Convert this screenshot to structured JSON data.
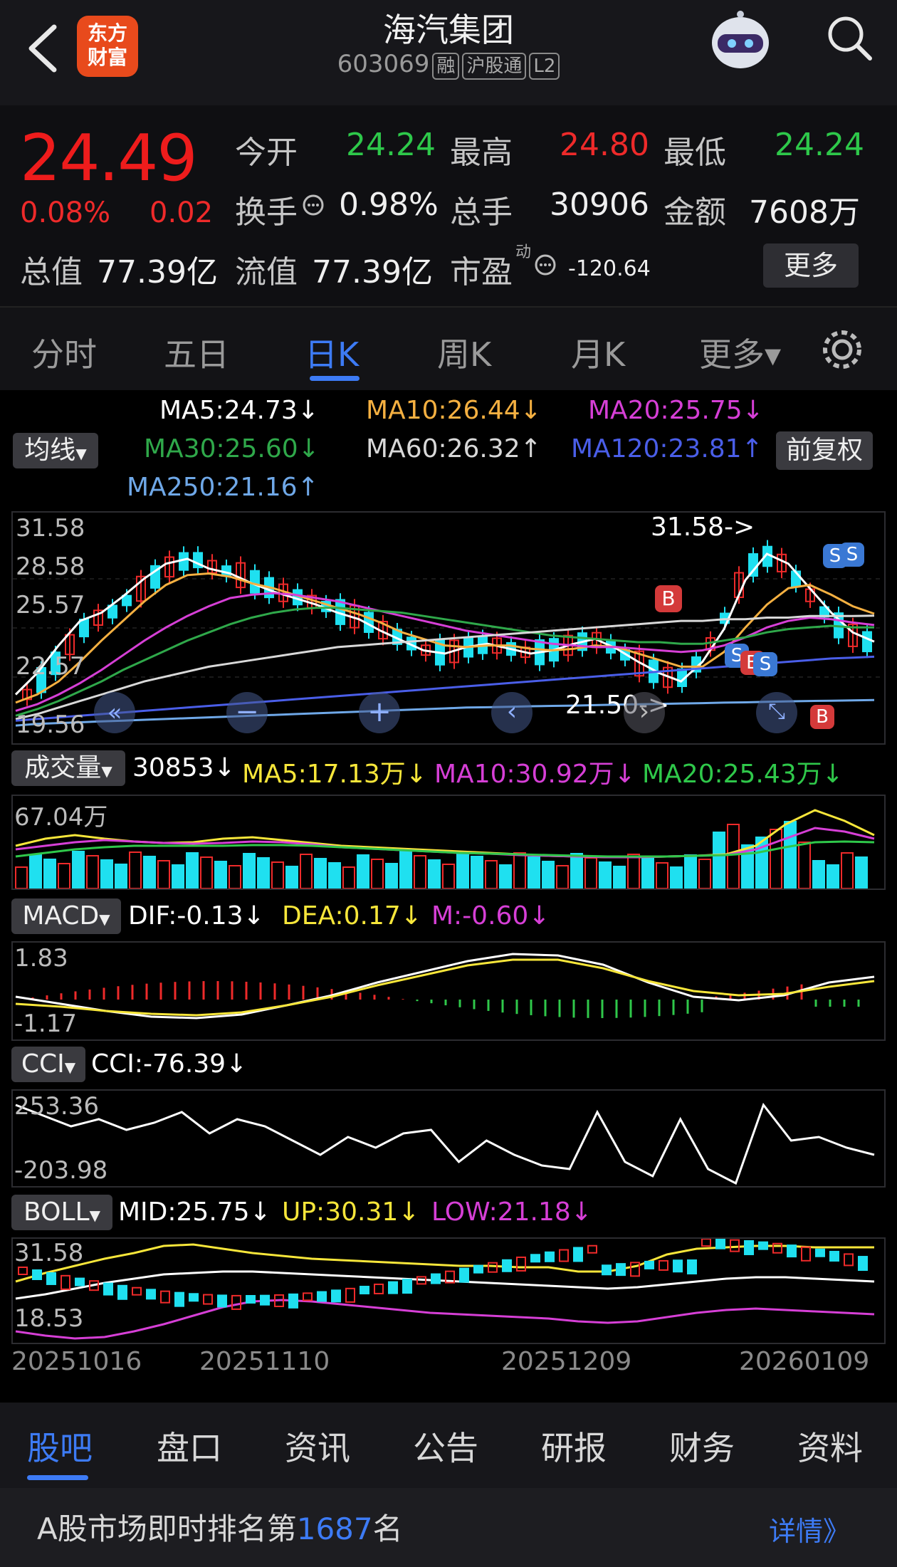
{
  "header": {
    "logo_text": "东方\n财富",
    "title": "海汽集团",
    "code": "603069",
    "tags": [
      "融",
      "沪股通",
      "L2"
    ]
  },
  "quote": {
    "price": "24.49",
    "change_pct": "0.08%",
    "change": "0.02",
    "open_label": "今开",
    "open": "24.24",
    "high_label": "最高",
    "high": "24.80",
    "low_label": "最低",
    "low": "24.24",
    "turnover_label": "换手",
    "turnover": "0.98%",
    "volume_label": "总手",
    "volume": "30906",
    "amount_label": "金额",
    "amount": "7608万",
    "mktcap_label": "总值",
    "mktcap": "77.39亿",
    "float_label": "流值",
    "float": "77.39亿",
    "pe_label": "市盈",
    "pe_sup": "动",
    "pe": "-120.64",
    "more_label": "更多"
  },
  "tabs": [
    "分时",
    "五日",
    "日K",
    "周K",
    "月K",
    "更多▾"
  ],
  "active_tab": 2,
  "ma_legend": {
    "ma5": "MA5:24.73↓",
    "ma10": "MA10:26.44↓",
    "ma20": "MA20:25.75↓",
    "ma30": "MA30:25.60↓",
    "ma60": "MA60:26.32↑",
    "ma120": "MA120:23.81↑",
    "ma250": "MA250:21.16↑",
    "selector": "均线",
    "adjust": "前复权"
  },
  "colors": {
    "ma5": "#ffffff",
    "ma10": "#f5b041",
    "ma20": "#d63fd6",
    "ma30": "#2fa84a",
    "ma60": "#d8d8d8",
    "ma120": "#4a5ee8",
    "ma250": "#6fa8e8",
    "up": "#ee2a2a",
    "down": "#1fe0f0"
  },
  "kline": {
    "y_ticks": [
      "31.58",
      "28.58",
      "25.57",
      "22.57",
      "19.56"
    ],
    "max_label": "31.58->",
    "min_label": "21.50->",
    "markers": [
      "B",
      "S",
      "S",
      "S",
      "B",
      "S",
      "B"
    ]
  },
  "volume": {
    "selector": "成交量",
    "value": "30853↓",
    "ma5": "MA5:17.13万↓",
    "ma10": "MA10:30.92万↓",
    "ma20": "MA20:25.43万↓",
    "y_top": "67.04万"
  },
  "macd": {
    "selector": "MACD",
    "dif": "DIF:-0.13↓",
    "dea": "DEA:0.17↓",
    "m": "M:-0.60↓",
    "y_top": "1.83",
    "y_bottom": "-1.17"
  },
  "cci": {
    "selector": "CCI",
    "value": "CCI:-76.39↓",
    "y_top": "253.36",
    "y_bottom": "-203.98"
  },
  "boll": {
    "selector": "BOLL",
    "mid": "MID:25.75↓",
    "up": "UP:30.31↓",
    "low": "LOW:21.18↓",
    "y_top": "31.58",
    "y_bottom": "18.53"
  },
  "dates": [
    "20251016",
    "20251110",
    "20251209",
    "20260109"
  ],
  "bottom_tabs": [
    "股吧",
    "盘口",
    "资讯",
    "公告",
    "研报",
    "财务",
    "资料"
  ],
  "rank": {
    "prefix": "A股市场即时排名第",
    "number": "1687",
    "suffix": "名",
    "details": "详情》"
  },
  "chart_data": [
    {
      "type": "line",
      "title": "",
      "note": "candlestick daily K-line with moving averages",
      "y_range": [
        19.56,
        31.58
      ],
      "series": [
        {
          "name": "MA5",
          "values": [
            21.5,
            22.8,
            24.5,
            26.0,
            26.5,
            27.5,
            28.6,
            29.5,
            29.8,
            29.2,
            28.9,
            28.3,
            27.8,
            27.4,
            27.0,
            26.5,
            26.1,
            25.4,
            24.8,
            24.2,
            24.0,
            24.4,
            24.6,
            24.3,
            24.0,
            24.2,
            24.6,
            24.9,
            24.3,
            23.5,
            22.8,
            22.3,
            23.5,
            25.5,
            28.5,
            30.1,
            29.5,
            28.0,
            26.5,
            25.3,
            24.73
          ]
        },
        {
          "name": "MA10",
          "values": [
            21.0,
            21.5,
            22.3,
            23.5,
            24.8,
            26.0,
            27.2,
            28.2,
            28.8,
            28.9,
            28.7,
            28.3,
            28.0,
            27.6,
            27.2,
            26.8,
            26.4,
            25.9,
            25.3,
            24.9,
            24.5,
            24.4,
            24.5,
            24.5,
            24.3,
            24.2,
            24.3,
            24.5,
            24.4,
            24.0,
            23.6,
            23.2,
            23.2,
            24.1,
            25.6,
            27.0,
            28.0,
            28.2,
            27.6,
            26.9,
            26.44
          ]
        },
        {
          "name": "MA20",
          "values": [
            20.5,
            20.9,
            21.5,
            22.2,
            23.0,
            23.9,
            24.8,
            25.6,
            26.3,
            26.9,
            27.4,
            27.6,
            27.7,
            27.6,
            27.4,
            27.2,
            26.9,
            26.6,
            26.3,
            26.0,
            25.7,
            25.4,
            25.2,
            25.0,
            24.8,
            24.6,
            24.5,
            24.4,
            24.4,
            24.3,
            24.2,
            24.1,
            24.2,
            24.5,
            25.0,
            25.6,
            26.0,
            26.2,
            26.1,
            25.9,
            25.75
          ]
        },
        {
          "name": "MA30",
          "values": [
            20.2,
            20.6,
            21.1,
            21.7,
            22.3,
            23.0,
            23.6,
            24.2,
            24.8,
            25.3,
            25.8,
            26.2,
            26.5,
            26.7,
            26.8,
            26.8,
            26.7,
            26.6,
            26.5,
            26.3,
            26.1,
            25.9,
            25.7,
            25.5,
            25.3,
            25.1,
            25.0,
            24.9,
            24.8,
            24.7,
            24.7,
            24.6,
            24.6,
            24.8,
            25.0,
            25.3,
            25.5,
            25.6,
            25.7,
            25.6,
            25.6
          ]
        },
        {
          "name": "MA60",
          "values": [
            20.0,
            20.3,
            20.7,
            21.1,
            21.5,
            21.9,
            22.3,
            22.6,
            22.9,
            23.2,
            23.4,
            23.6,
            23.8,
            24.0,
            24.2,
            24.4,
            24.5,
            24.6,
            24.7,
            24.8,
            24.9,
            25.0,
            25.1,
            25.2,
            25.3,
            25.4,
            25.5,
            25.6,
            25.7,
            25.8,
            25.9,
            26.0,
            26.0,
            26.1,
            26.1,
            26.2,
            26.2,
            26.3,
            26.3,
            26.3,
            26.32
          ]
        },
        {
          "name": "MA120",
          "values": [
            19.9,
            20.0,
            20.1,
            20.2,
            20.3,
            20.4,
            20.5,
            20.6,
            20.7,
            20.8,
            20.9,
            21.0,
            21.1,
            21.2,
            21.3,
            21.4,
            21.5,
            21.6,
            21.7,
            21.8,
            21.9,
            22.0,
            22.1,
            22.2,
            22.3,
            22.4,
            22.5,
            22.6,
            22.7,
            22.8,
            22.9,
            23.0,
            23.1,
            23.2,
            23.3,
            23.4,
            23.5,
            23.6,
            23.7,
            23.75,
            23.81
          ]
        },
        {
          "name": "MA250",
          "values": [
            19.6,
            19.7,
            19.75,
            19.8,
            19.85,
            19.9,
            19.95,
            20.0,
            20.05,
            20.1,
            20.15,
            20.2,
            20.25,
            20.3,
            20.35,
            20.4,
            20.45,
            20.5,
            20.55,
            20.6,
            20.65,
            20.7,
            20.72,
            20.75,
            20.78,
            20.8,
            20.82,
            20.85,
            20.88,
            20.9,
            20.92,
            20.95,
            20.97,
            21.0,
            21.02,
            21.05,
            21.08,
            21.1,
            21.12,
            21.14,
            21.16
          ]
        }
      ]
    }
  ]
}
